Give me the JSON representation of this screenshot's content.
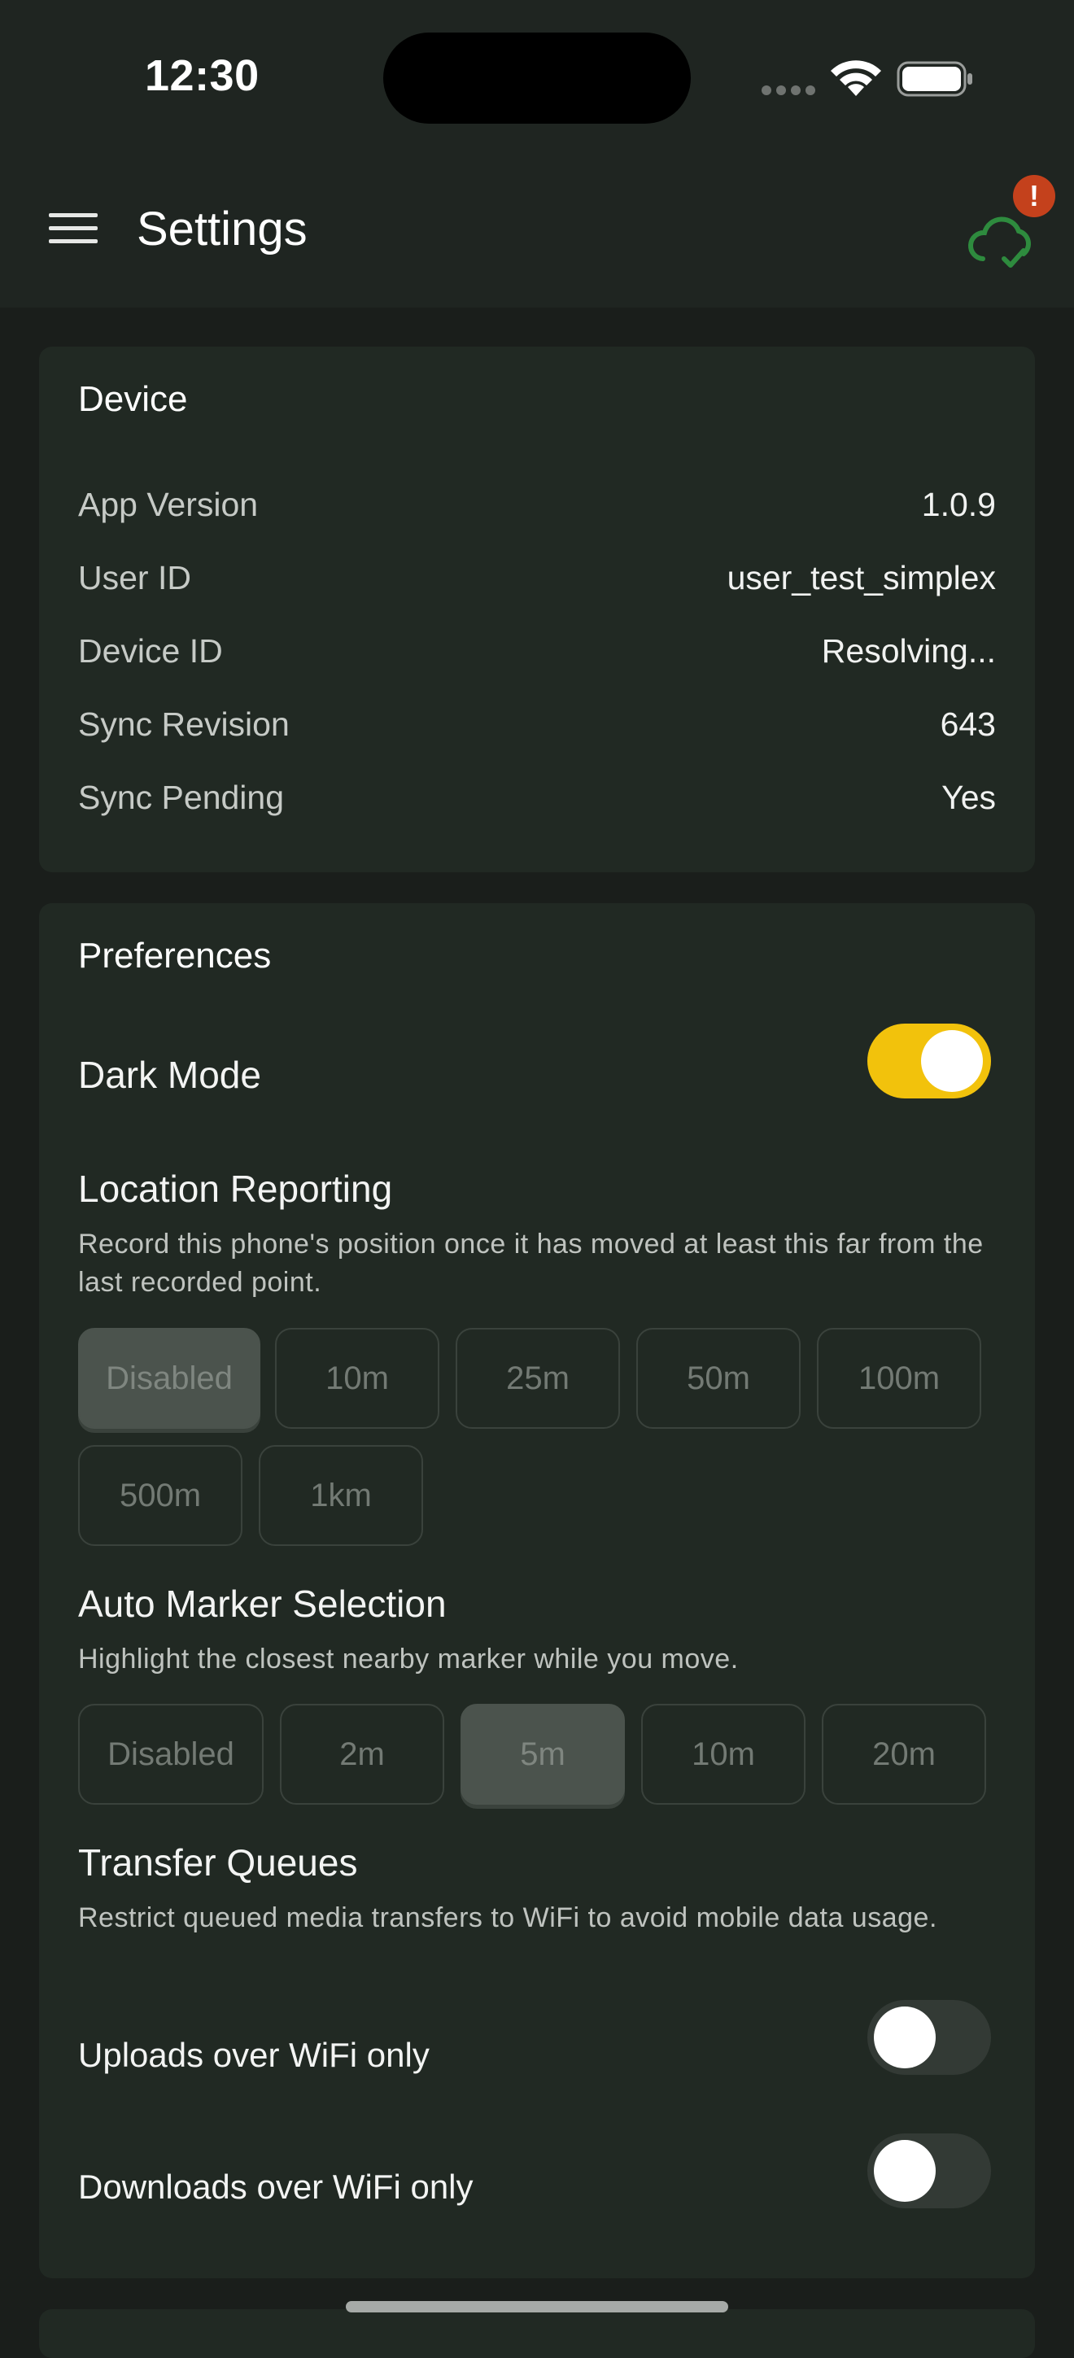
{
  "status_bar": {
    "time": "12:30"
  },
  "app_bar": {
    "title": "Settings",
    "sync_badge": "!"
  },
  "device": {
    "title": "Device",
    "rows": [
      {
        "label": "App Version",
        "value": "1.0.9"
      },
      {
        "label": "User ID",
        "value": "user_test_simplex"
      },
      {
        "label": "Device ID",
        "value": "Resolving..."
      },
      {
        "label": "Sync Revision",
        "value": "643"
      },
      {
        "label": "Sync Pending",
        "value": "Yes"
      }
    ]
  },
  "preferences": {
    "title": "Preferences",
    "dark_mode": {
      "label": "Dark Mode",
      "enabled": true
    },
    "location_reporting": {
      "label": "Location Reporting",
      "description": "Record this phone's position once it has moved at least this far from the last recorded point.",
      "options": [
        "Disabled",
        "10m",
        "25m",
        "50m",
        "100m",
        "500m",
        "1km"
      ],
      "selected": "Disabled"
    },
    "auto_marker": {
      "label": "Auto Marker Selection",
      "description": "Highlight the closest nearby marker while you move.",
      "options": [
        "Disabled",
        "2m",
        "5m",
        "10m",
        "20m"
      ],
      "selected": "5m"
    },
    "transfer_queues": {
      "label": "Transfer Queues",
      "description": "Restrict queued media transfers to WiFi to avoid mobile data usage.",
      "uploads": {
        "label": "Uploads over WiFi only",
        "enabled": false
      },
      "downloads": {
        "label": "Downloads over WiFi only",
        "enabled": false
      }
    }
  },
  "colors": {
    "accent": "#f2c20c",
    "sync_icon": "#2e8b3e",
    "badge": "#c4411c",
    "background": "#1a1e1b",
    "card": "#212923"
  }
}
